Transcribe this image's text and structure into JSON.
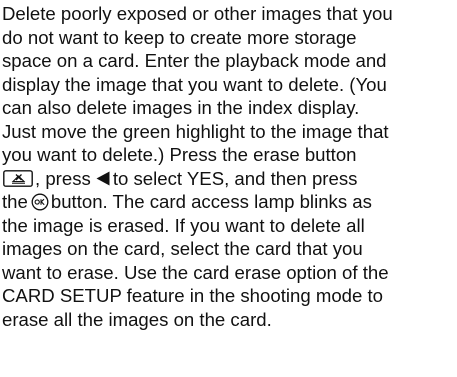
{
  "paragraph": {
    "line_01": "Delete poorly exposed or other images that you",
    "line_02": "do not want to keep to create more storage",
    "line_03": "space on a card. Enter the playback mode and",
    "line_04": "display the image that you want to delete. (You",
    "line_05": "can also delete images in the index display.",
    "line_06": "Just move the green highlight to the image that",
    "line_07": "you want to delete.) Press the erase button",
    "line_08_after_icon": ", press",
    "line_08_end": "to select YES, and then press",
    "line_09_start": "the",
    "line_09_end": "button. The card access lamp blinks as",
    "line_10": "the image is erased. If you want to delete all",
    "line_11": "images on the card, select the card that you",
    "line_12": "want to erase. Use the card erase option of the",
    "line_13": "CARD SETUP feature in the shooting mode to",
    "line_14": "erase all the images on the card."
  },
  "icons": {
    "erase_button": "erase-button-icon",
    "left_arrow": "left-arrow-icon",
    "ok_button": "ok-button-icon"
  },
  "colors": {
    "text": "#111111",
    "background": "#ffffff"
  }
}
